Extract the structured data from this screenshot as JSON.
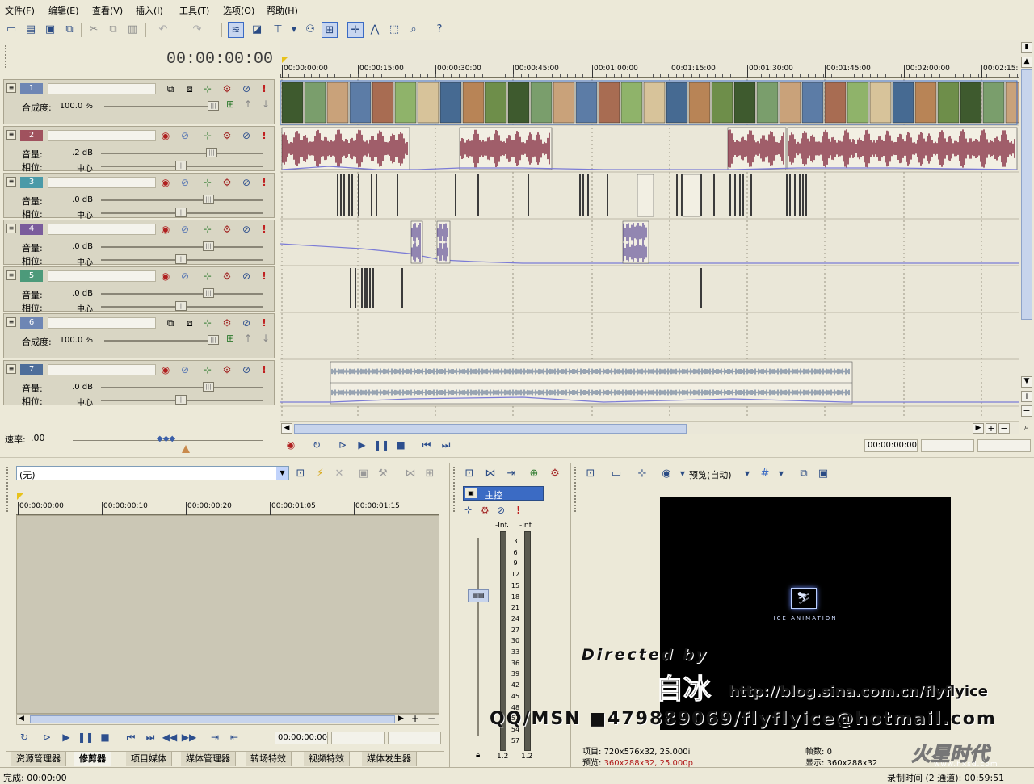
{
  "menu": [
    "文件(F)",
    "编辑(E)",
    "查看(V)",
    "插入(I)",
    "工具(T)",
    "选项(O)",
    "帮助(H)"
  ],
  "timeline": {
    "timecode": "00:00:00:00",
    "ruler_ticks": [
      "00:00:00:00",
      "00:00:15:00",
      "00:00:30:00",
      "00:00:45:00",
      "00:01:00:00",
      "00:01:15:00",
      "00:01:30:00",
      "00:01:45:00",
      "00:02:00:00",
      "00:02:15:"
    ],
    "position_timecode": "00:00:00:00"
  },
  "tracks": [
    {
      "num": "1",
      "type": "video",
      "color": "#6e86b4",
      "label1": "合成度:",
      "value1": "100.0 %",
      "level": 1.0
    },
    {
      "num": "2",
      "type": "audio",
      "color": "#a0525e",
      "label1": "音量:",
      "value1": ".2 dB",
      "label2": "相位:",
      "value2": "中心",
      "level": 0.7
    },
    {
      "num": "3",
      "type": "audio",
      "color": "#4a9aa8",
      "label1": "音量:",
      "value1": ".0 dB",
      "label2": "相位:",
      "value2": "中心",
      "level": 0.68
    },
    {
      "num": "4",
      "type": "audio",
      "color": "#7a5c9c",
      "label1": "音量:",
      "value1": ".0 dB",
      "label2": "相位:",
      "value2": "中心",
      "level": 0.68
    },
    {
      "num": "5",
      "type": "audio",
      "color": "#4c9a7a",
      "label1": "音量:",
      "value1": ".0 dB",
      "label2": "相位:",
      "value2": "中心",
      "level": 0.68
    },
    {
      "num": "6",
      "type": "video",
      "color": "#6e86b4",
      "label1": "合成度:",
      "value1": "100.0 %",
      "level": 1.0
    },
    {
      "num": "7",
      "type": "audio",
      "color": "#4e6e9a",
      "label1": "音量:",
      "value1": ".0 dB",
      "label2": "相位:",
      "value2": "中心",
      "level": 0.68
    }
  ],
  "rate": {
    "label": "速率:",
    "value": ".00"
  },
  "trimmer": {
    "select_value": "(无)",
    "ruler_ticks": [
      "00:00:00:00",
      "00:00:00:10",
      "00:00:00:20",
      "00:00:01:05",
      "00:00:01:15"
    ],
    "timecode": "00:00:00:00"
  },
  "tabs": [
    "资源管理器",
    "修剪器",
    "项目媒体",
    "媒体管理器",
    "转场特效",
    "视频特效",
    "媒体发生器"
  ],
  "active_tab": "修剪器",
  "mixer": {
    "master_label": "主控",
    "left_peak": "-Inf.",
    "right_peak": "-Inf.",
    "scale": [
      "3",
      "6",
      "9",
      "12",
      "15",
      "18",
      "21",
      "24",
      "27",
      "30",
      "33",
      "36",
      "39",
      "42",
      "45",
      "48",
      "51",
      "54",
      "57"
    ],
    "left_value": "1.2",
    "right_value": "1.2"
  },
  "preview": {
    "mode_label": "预览(自动)",
    "logo_text": "ICE ANIMATION",
    "project_label": "项目:",
    "project_value": "720x576x32, 25.000i",
    "preview_label": "预览:",
    "preview_value": "360x288x32, 25.000p",
    "frame_label": "帧数:",
    "frame_value": "0",
    "display_label": "显示:",
    "display_value": "360x288x32"
  },
  "watermark": {
    "directed_by": "Directed by",
    "name": "自冰",
    "url": "http://blog.sina.com.cn/flyflyice",
    "contact": "QQ/MSN ■479889069/flyflyice@hotmail.com",
    "site_logo": "火星时代",
    "site_url": "www.hxsd.com"
  },
  "status": {
    "left": "完成: 00:00:00",
    "right": "录制时间 (2 通道): 00:59:51"
  },
  "colors": {
    "audio_wave": "#8b3a4c",
    "envelope": "#7b7bd6",
    "selection": "#3b6bc4"
  }
}
